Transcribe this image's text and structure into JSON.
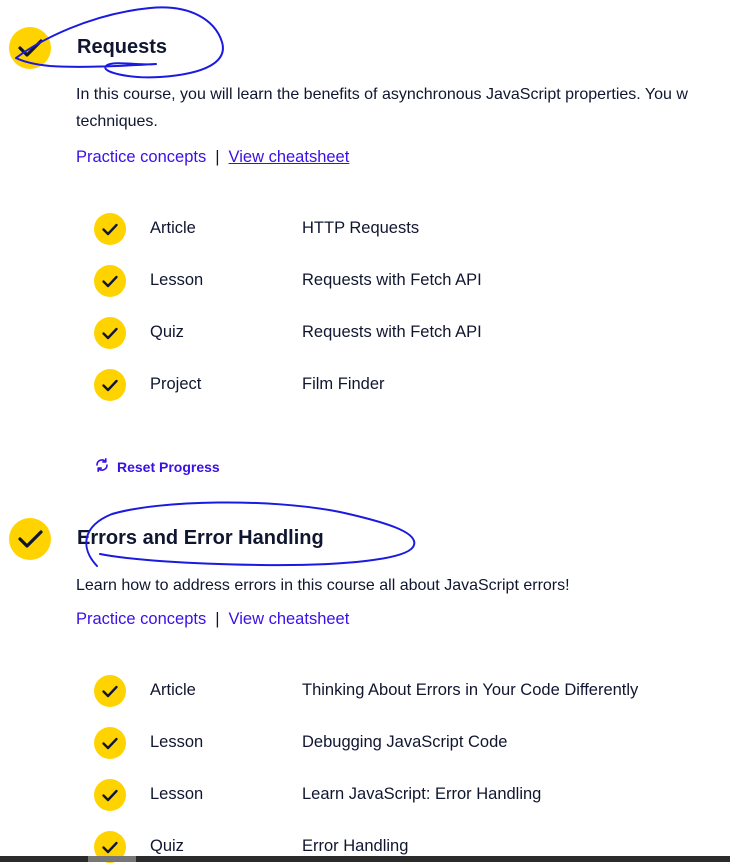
{
  "colors": {
    "accent_yellow": "#ffd300",
    "link_purple": "#3a10e5",
    "text_navy": "#10162f",
    "annotation_blue": "#1a1ae0"
  },
  "modules": [
    {
      "title": "Requests",
      "description_line1": "In this course, you will learn the benefits of asynchronous JavaScript properties. You w",
      "description_line2": "techniques.",
      "practice_label": "Practice concepts",
      "separator": "|",
      "cheatsheet_label": "View cheatsheet",
      "icon": "check-icon",
      "items": [
        {
          "type": "Article",
          "title": "HTTP Requests",
          "icon": "check-icon"
        },
        {
          "type": "Lesson",
          "title": "Requests with Fetch API",
          "icon": "check-icon"
        },
        {
          "type": "Quiz",
          "title": "Requests with Fetch API",
          "icon": "check-icon"
        },
        {
          "type": "Project",
          "title": "Film Finder",
          "icon": "check-icon"
        }
      ],
      "reset_label": "Reset Progress",
      "reset_icon": "refresh-icon"
    },
    {
      "title": "Errors and Error Handling",
      "description_line1": "Learn how to address errors in this course all about JavaScript errors!",
      "practice_label": "Practice concepts",
      "separator": "|",
      "cheatsheet_label": "View cheatsheet",
      "icon": "check-icon",
      "items": [
        {
          "type": "Article",
          "title": "Thinking About Errors in Your Code Differently",
          "icon": "check-icon"
        },
        {
          "type": "Lesson",
          "title": "Debugging JavaScript Code",
          "icon": "check-icon"
        },
        {
          "type": "Lesson",
          "title": "Learn JavaScript: Error Handling",
          "icon": "check-icon"
        },
        {
          "type": "Quiz",
          "title": "Error Handling",
          "icon": "check-icon"
        }
      ]
    }
  ]
}
